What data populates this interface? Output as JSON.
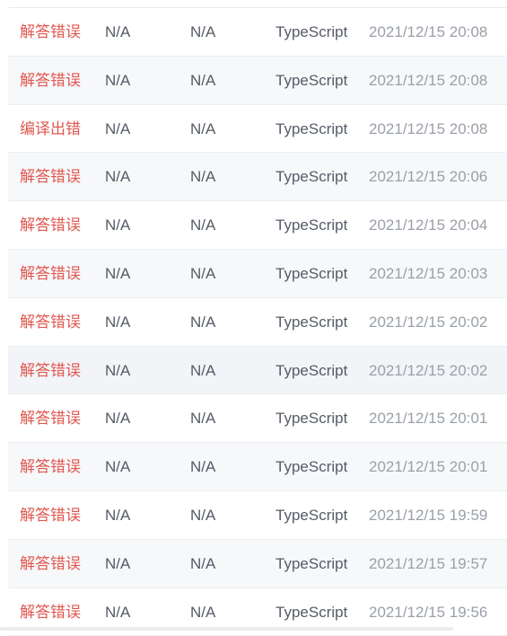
{
  "submissions": [
    {
      "status": "解答错误",
      "runtime": "N/A",
      "memory": "N/A",
      "language": "TypeScript",
      "submitted_at": "2021/12/15 20:08"
    },
    {
      "status": "解答错误",
      "runtime": "N/A",
      "memory": "N/A",
      "language": "TypeScript",
      "submitted_at": "2021/12/15 20:08"
    },
    {
      "status": "编译出错",
      "runtime": "N/A",
      "memory": "N/A",
      "language": "TypeScript",
      "submitted_at": "2021/12/15 20:08"
    },
    {
      "status": "解答错误",
      "runtime": "N/A",
      "memory": "N/A",
      "language": "TypeScript",
      "submitted_at": "2021/12/15 20:06"
    },
    {
      "status": "解答错误",
      "runtime": "N/A",
      "memory": "N/A",
      "language": "TypeScript",
      "submitted_at": "2021/12/15 20:04"
    },
    {
      "status": "解答错误",
      "runtime": "N/A",
      "memory": "N/A",
      "language": "TypeScript",
      "submitted_at": "2021/12/15 20:03"
    },
    {
      "status": "解答错误",
      "runtime": "N/A",
      "memory": "N/A",
      "language": "TypeScript",
      "submitted_at": "2021/12/15 20:02"
    },
    {
      "status": "解答错误",
      "runtime": "N/A",
      "memory": "N/A",
      "language": "TypeScript",
      "submitted_at": "2021/12/15 20:02"
    },
    {
      "status": "解答错误",
      "runtime": "N/A",
      "memory": "N/A",
      "language": "TypeScript",
      "submitted_at": "2021/12/15 20:01"
    },
    {
      "status": "解答错误",
      "runtime": "N/A",
      "memory": "N/A",
      "language": "TypeScript",
      "submitted_at": "2021/12/15 20:01"
    },
    {
      "status": "解答错误",
      "runtime": "N/A",
      "memory": "N/A",
      "language": "TypeScript",
      "submitted_at": "2021/12/15 19:59"
    },
    {
      "status": "解答错误",
      "runtime": "N/A",
      "memory": "N/A",
      "language": "TypeScript",
      "submitted_at": "2021/12/15 19:57"
    },
    {
      "status": "解答错误",
      "runtime": "N/A",
      "memory": "N/A",
      "language": "TypeScript",
      "submitted_at": "2021/12/15 19:56"
    }
  ],
  "colors": {
    "status_error": "#e0574f",
    "text_primary": "#555b66",
    "text_muted": "#9aa0a8",
    "row_alt_bg": "#f7f8fa"
  }
}
